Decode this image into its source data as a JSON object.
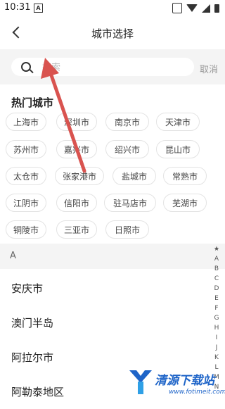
{
  "status": {
    "time": "10:31",
    "notif_letter": "A"
  },
  "header": {
    "title": "城市选择"
  },
  "search": {
    "placeholder": "搜索",
    "cancel": "取消"
  },
  "hot": {
    "title": "热门城市",
    "cities": [
      "上海市",
      "深圳市",
      "南京市",
      "天津市",
      "苏州市",
      "嘉兴市",
      "绍兴市",
      "昆山市",
      "太仓市",
      "张家港市",
      "盐城市",
      "常熟市",
      "江阴市",
      "信阳市",
      "驻马店市",
      "芜湖市",
      "铜陵市",
      "三亚市",
      "日照市"
    ]
  },
  "list": {
    "section_letter": "A",
    "cities": [
      "安庆市",
      "澳门半岛",
      "阿拉尔市",
      "阿勒泰地区"
    ]
  },
  "index_letters": [
    "★",
    "A",
    "B",
    "C",
    "D",
    "E",
    "F",
    "G",
    "H",
    "I",
    "J",
    "K",
    "L",
    "M",
    "N"
  ],
  "watermark": {
    "name": "清源下载站",
    "url": "www.fotimeit.com"
  },
  "colors": {
    "arrow": "#d9534f",
    "watermark": "#1e64c8"
  }
}
